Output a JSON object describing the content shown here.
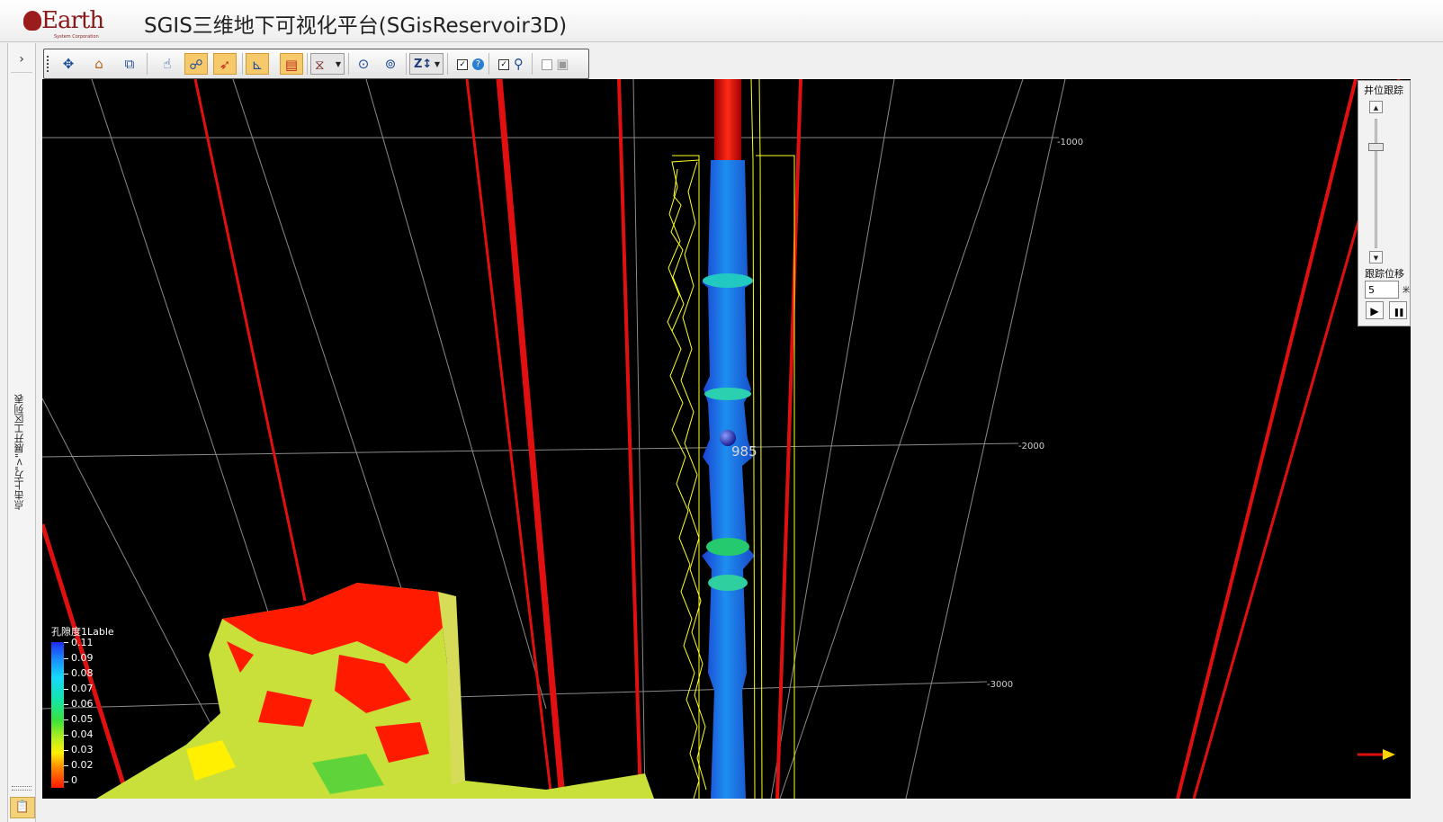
{
  "app": {
    "logo_text": "Earth",
    "logo_sub": "System Corporation",
    "title": "SGIS三维地下可视化平台(SGisReservoir3D)"
  },
  "left_panel": {
    "expand_glyph": "›",
    "hint": "点击上方\">\"展开工区列表"
  },
  "toolbar": {
    "items": [
      {
        "name": "pan-tool",
        "icon": "move-arrows-icon",
        "glyph": "✥",
        "active": false
      },
      {
        "name": "home-view",
        "icon": "home-icon",
        "glyph": "⌂",
        "active": false
      },
      {
        "name": "3d-box",
        "icon": "cube-icon",
        "glyph": "⧉",
        "active": false
      },
      {
        "name": "select-tool",
        "icon": "pointer-icon",
        "glyph": "☝",
        "active": false
      },
      {
        "name": "well-link",
        "icon": "link-nodes-icon",
        "glyph": "☍",
        "active": true
      },
      {
        "name": "trajectory",
        "icon": "rocket-icon",
        "glyph": "➶",
        "active": true
      },
      {
        "name": "axis-grid",
        "icon": "axis-icon",
        "glyph": "⊾",
        "active": true
      },
      {
        "name": "color-bar",
        "icon": "colorbar-icon",
        "glyph": "▤",
        "active": true
      },
      {
        "name": "light-source",
        "icon": "lamp-icon",
        "glyph": "⧖",
        "active": false
      },
      {
        "name": "view-up",
        "icon": "eye-up-icon",
        "glyph": "⊙",
        "active": false
      },
      {
        "name": "view-down",
        "icon": "eye-down-icon",
        "glyph": "⊚",
        "active": false
      },
      {
        "name": "z-scale",
        "icon": "z-scale-icon",
        "glyph": "Z↕",
        "active": false
      },
      {
        "name": "info-toggle",
        "icon": "help-bubble-icon",
        "glyph": "?",
        "active": false
      },
      {
        "name": "well-track",
        "icon": "well-eye-icon",
        "glyph": "⚲",
        "active": false
      },
      {
        "name": "report-view",
        "icon": "report-icon",
        "glyph": "▣",
        "active": false
      }
    ],
    "checkbox_mark": "✓"
  },
  "viewport": {
    "depth_labels": [
      "-1000",
      "-2000",
      "-3000"
    ],
    "well_label": "985"
  },
  "legend": {
    "title": "孔隙度1Lable",
    "values": [
      "0.11",
      "0.09",
      "0.08",
      "0.07",
      "0.06",
      "0.05",
      "0.04",
      "0.03",
      "0.02",
      "0"
    ],
    "colors": [
      "#1f2df5",
      "#1a8fff",
      "#16d9ff",
      "#12e6a8",
      "#3de23a",
      "#b8ee20",
      "#fff100",
      "#ff8a00",
      "#ff1a00"
    ]
  },
  "track_panel": {
    "title": "井位跟踪",
    "slider_level": 0.2,
    "offset_label": "跟踪位移",
    "offset_value": "5",
    "offset_unit": "米",
    "play_glyph": "▶",
    "pause_glyph": "❚❚"
  },
  "colors": {
    "well_tube": "#e01010",
    "log_curve": "#ffff22",
    "grid": "#8a8a8a",
    "tracking_arrow": "#ffd400"
  }
}
